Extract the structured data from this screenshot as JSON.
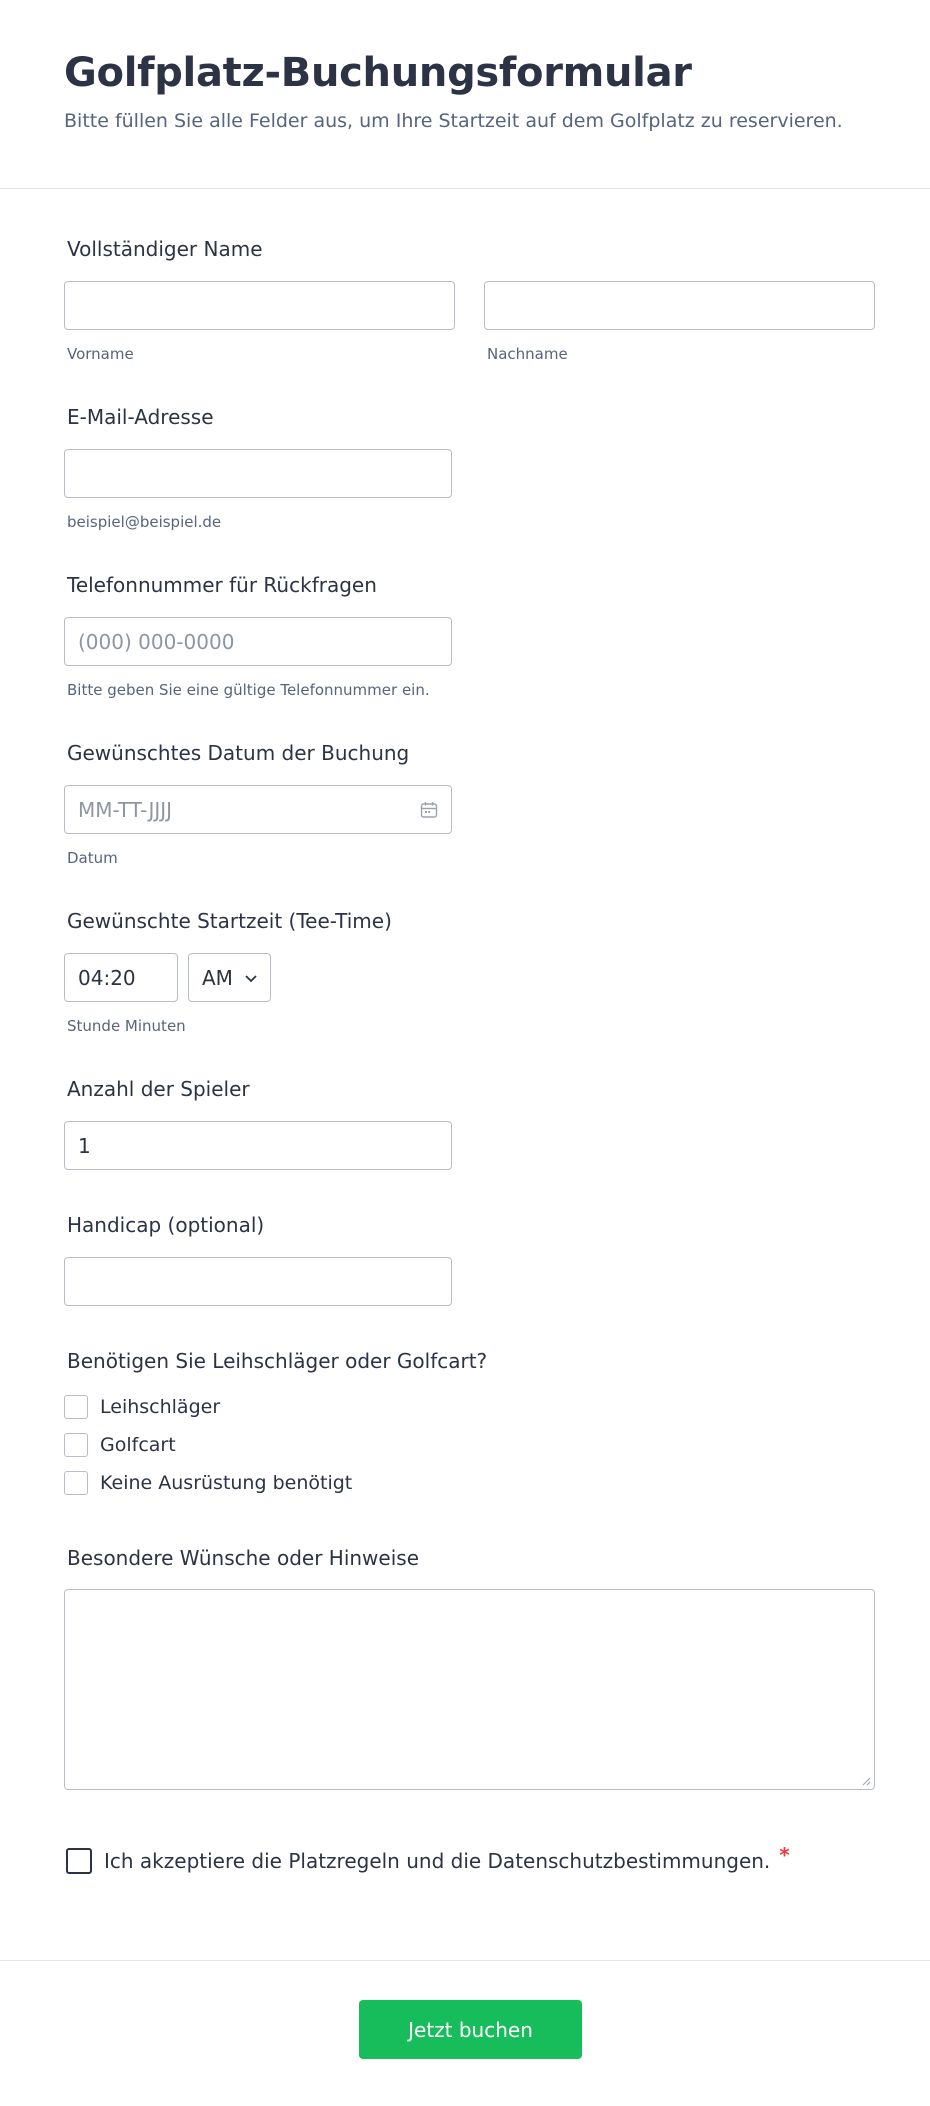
{
  "header": {
    "title": "Golfplatz-Buchungsformular",
    "subtitle": "Bitte füllen Sie alle Felder aus, um Ihre Startzeit auf dem Golfplatz zu reservieren."
  },
  "name": {
    "label": "Vollständiger Name",
    "first_value": "",
    "first_sublabel": "Vorname",
    "last_value": "",
    "last_sublabel": "Nachname"
  },
  "email": {
    "label": "E-Mail-Adresse",
    "value": "",
    "sublabel": "beispiel@beispiel.de"
  },
  "phone": {
    "label": "Telefonnummer für Rückfragen",
    "placeholder": "(000) 000-0000",
    "sublabel": "Bitte geben Sie eine gültige Telefonnummer ein."
  },
  "date": {
    "label": "Gewünschtes Datum der Buchung",
    "placeholder": "MM-TT-JJJJ",
    "sublabel": "Datum",
    "icon": "calendar-icon"
  },
  "time": {
    "label": "Gewünschte Startzeit (Tee-Time)",
    "value": "04:20",
    "ampm": "AM",
    "sublabel": "Stunde Minuten"
  },
  "players": {
    "label": "Anzahl der Spieler",
    "value": "1"
  },
  "handicap": {
    "label": "Handicap (optional)",
    "value": ""
  },
  "equipment": {
    "label": "Benötigen Sie Leihschläger oder Golfcart?",
    "options": [
      "Leihschläger",
      "Golfcart",
      "Keine Ausrüstung benötigt"
    ]
  },
  "notes": {
    "label": "Besondere Wünsche oder Hinweise",
    "value": ""
  },
  "terms": {
    "text": "Ich akzeptiere die Platzregeln und die Datenschutzbestimmungen.",
    "required_mark": "*"
  },
  "submit": {
    "label": "Jetzt buchen"
  },
  "colors": {
    "accent": "#18bd5b",
    "text": "#2c3345",
    "muted": "#57647e",
    "border": "#b8bdc9",
    "required": "#f23a3c"
  }
}
